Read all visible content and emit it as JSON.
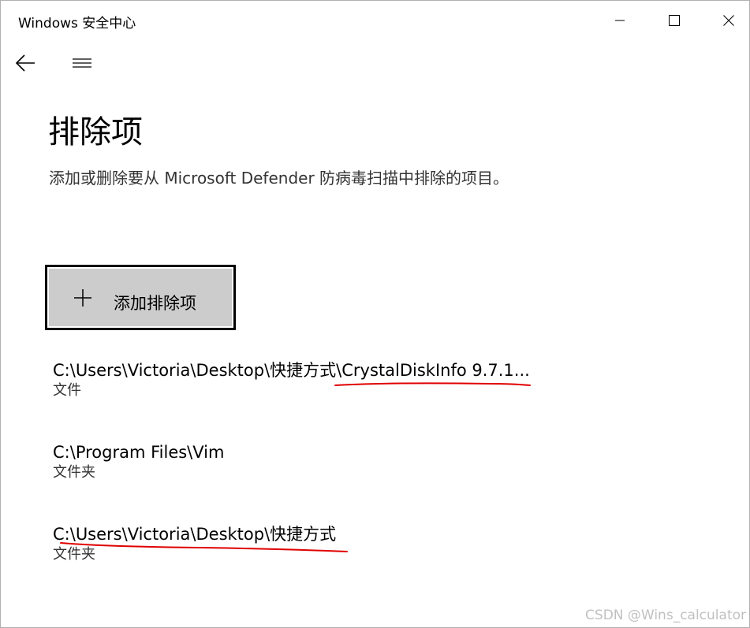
{
  "window": {
    "title": "Windows 安全中心"
  },
  "page": {
    "title": "排除项",
    "description": "添加或删除要从 Microsoft Defender 防病毒扫描中排除的项目。"
  },
  "add_button": {
    "label": "添加排除项",
    "icon": "plus-icon"
  },
  "exclusions": [
    {
      "path": "C:\\Users\\Victoria\\Desktop\\快捷方式\\CrystalDiskInfo 9.7.1...",
      "type": "文件"
    },
    {
      "path": "C:\\Program Files\\Vim",
      "type": "文件夹"
    },
    {
      "path": "C:\\Users\\Victoria\\Desktop\\快捷方式",
      "type": "文件夹"
    }
  ],
  "annotation_color": "#e00000",
  "watermark": "CSDN @Wins_calculator"
}
